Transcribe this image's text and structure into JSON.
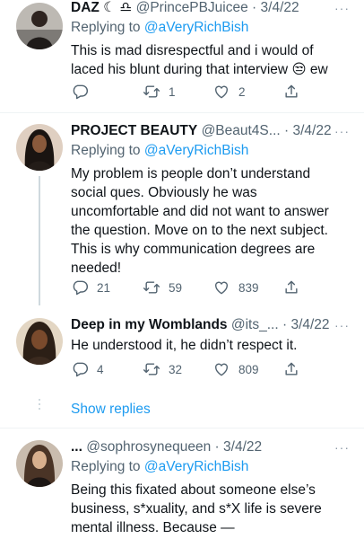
{
  "tweets": [
    {
      "name": "DAZ ☾ ♎︎",
      "handle": "@PrincePBJuicee",
      "date": "3/4/22",
      "replying_prefix": "Replying to",
      "replying_handle": "@aVeryRichBish",
      "text": "This is mad disrespectful and i would of laced his blunt during that interview 😒 ew",
      "replies": "",
      "retweets": "1",
      "likes": "2"
    },
    {
      "name": "PROJECT BEAUTY",
      "handle": "@Beaut4S...",
      "date": "3/4/22",
      "replying_prefix": "Replying to",
      "replying_handle": "@aVeryRichBish",
      "text": "My problem is people don’t understand social ques. Obviously he was uncomfortable and did not want to answer the question. Move on to the next subject. This is why communication degrees are needed!",
      "replies": "21",
      "retweets": "59",
      "likes": "839"
    },
    {
      "name": "Deep in my Womblands",
      "handle": "@its_...",
      "date": "3/4/22",
      "text": "He understood it, he didn’t respect it.",
      "replies": "4",
      "retweets": "32",
      "likes": "809"
    },
    {
      "name": "...",
      "handle": "@sophrosynequeen",
      "date": "3/4/22",
      "replying_prefix": "Replying to",
      "replying_handle": "@aVeryRichBish",
      "text": "Being this fixated about someone else’s business, s*xuality, and s*X life is severe mental illness. Because —"
    }
  ],
  "show_replies_label": "Show replies",
  "more_glyph": "···",
  "dot_separator": "·",
  "colors": {
    "text_primary": "#0f1419",
    "text_secondary": "#536471",
    "link": "#1d9bf0",
    "divider": "#eff3f4",
    "thread_line": "#cfd9de"
  }
}
